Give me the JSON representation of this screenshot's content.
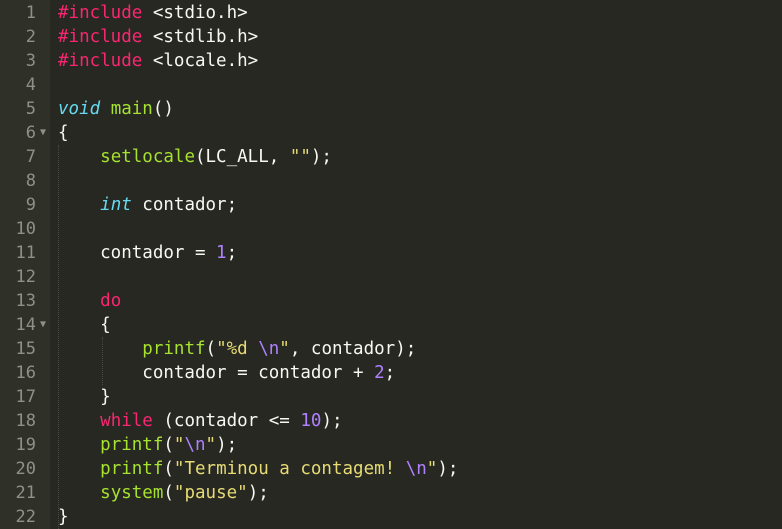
{
  "editor": {
    "lines": [
      {
        "n": "1",
        "fold": false,
        "tokens": [
          {
            "t": "#include",
            "c": "pre"
          },
          {
            "t": " <stdio.h>",
            "c": "inc"
          }
        ]
      },
      {
        "n": "2",
        "fold": false,
        "tokens": [
          {
            "t": "#include",
            "c": "pre"
          },
          {
            "t": " <stdlib.h>",
            "c": "inc"
          }
        ]
      },
      {
        "n": "3",
        "fold": false,
        "tokens": [
          {
            "t": "#include",
            "c": "pre"
          },
          {
            "t": " <locale.h>",
            "c": "inc"
          }
        ]
      },
      {
        "n": "4",
        "fold": false,
        "tokens": []
      },
      {
        "n": "5",
        "fold": false,
        "tokens": [
          {
            "t": "void",
            "c": "type"
          },
          {
            "t": " ",
            "c": "plain"
          },
          {
            "t": "main",
            "c": "fn"
          },
          {
            "t": "()",
            "c": "plain"
          }
        ]
      },
      {
        "n": "6",
        "fold": true,
        "tokens": [
          {
            "t": "{",
            "c": "plain"
          }
        ]
      },
      {
        "n": "7",
        "fold": false,
        "tokens": [
          {
            "t": "    ",
            "c": "plain"
          },
          {
            "t": "setlocale",
            "c": "fn"
          },
          {
            "t": "(LC_ALL, ",
            "c": "plain"
          },
          {
            "t": "\"\"",
            "c": "str"
          },
          {
            "t": ");",
            "c": "plain"
          }
        ]
      },
      {
        "n": "8",
        "fold": false,
        "tokens": []
      },
      {
        "n": "9",
        "fold": false,
        "tokens": [
          {
            "t": "    ",
            "c": "plain"
          },
          {
            "t": "int",
            "c": "type"
          },
          {
            "t": " contador;",
            "c": "plain"
          }
        ]
      },
      {
        "n": "10",
        "fold": false,
        "tokens": []
      },
      {
        "n": "11",
        "fold": false,
        "tokens": [
          {
            "t": "    contador = ",
            "c": "plain"
          },
          {
            "t": "1",
            "c": "num"
          },
          {
            "t": ";",
            "c": "plain"
          }
        ]
      },
      {
        "n": "12",
        "fold": false,
        "tokens": []
      },
      {
        "n": "13",
        "fold": false,
        "tokens": [
          {
            "t": "    ",
            "c": "plain"
          },
          {
            "t": "do",
            "c": "kw"
          }
        ]
      },
      {
        "n": "14",
        "fold": true,
        "tokens": [
          {
            "t": "    {",
            "c": "plain"
          }
        ]
      },
      {
        "n": "15",
        "fold": false,
        "tokens": [
          {
            "t": "        ",
            "c": "plain"
          },
          {
            "t": "printf",
            "c": "fn"
          },
          {
            "t": "(",
            "c": "plain"
          },
          {
            "t": "\"%d ",
            "c": "str"
          },
          {
            "t": "\\n",
            "c": "esc"
          },
          {
            "t": "\"",
            "c": "str"
          },
          {
            "t": ", contador);",
            "c": "plain"
          }
        ]
      },
      {
        "n": "16",
        "fold": false,
        "tokens": [
          {
            "t": "        contador = contador + ",
            "c": "plain"
          },
          {
            "t": "2",
            "c": "num"
          },
          {
            "t": ";",
            "c": "plain"
          }
        ]
      },
      {
        "n": "17",
        "fold": false,
        "tokens": [
          {
            "t": "    }",
            "c": "plain"
          }
        ]
      },
      {
        "n": "18",
        "fold": false,
        "tokens": [
          {
            "t": "    ",
            "c": "plain"
          },
          {
            "t": "while",
            "c": "kw"
          },
          {
            "t": " (contador <= ",
            "c": "plain"
          },
          {
            "t": "10",
            "c": "num"
          },
          {
            "t": ");",
            "c": "plain"
          }
        ]
      },
      {
        "n": "19",
        "fold": false,
        "tokens": [
          {
            "t": "    ",
            "c": "plain"
          },
          {
            "t": "printf",
            "c": "fn"
          },
          {
            "t": "(",
            "c": "plain"
          },
          {
            "t": "\"",
            "c": "str"
          },
          {
            "t": "\\n",
            "c": "esc"
          },
          {
            "t": "\"",
            "c": "str"
          },
          {
            "t": ");",
            "c": "plain"
          }
        ]
      },
      {
        "n": "20",
        "fold": false,
        "tokens": [
          {
            "t": "    ",
            "c": "plain"
          },
          {
            "t": "printf",
            "c": "fn"
          },
          {
            "t": "(",
            "c": "plain"
          },
          {
            "t": "\"Terminou a contagem! ",
            "c": "str"
          },
          {
            "t": "\\n",
            "c": "esc"
          },
          {
            "t": "\"",
            "c": "str"
          },
          {
            "t": ");",
            "c": "plain"
          }
        ]
      },
      {
        "n": "21",
        "fold": false,
        "tokens": [
          {
            "t": "    ",
            "c": "plain"
          },
          {
            "t": "system",
            "c": "fn"
          },
          {
            "t": "(",
            "c": "plain"
          },
          {
            "t": "\"pause\"",
            "c": "str"
          },
          {
            "t": ");",
            "c": "plain"
          }
        ]
      },
      {
        "n": "22",
        "fold": false,
        "tokens": [
          {
            "t": "}",
            "c": "plain"
          }
        ]
      }
    ],
    "fold_icon": "fold-arrow-icon",
    "colors": {
      "background": "#272822",
      "gutter": "#2f3129",
      "line_number": "#8f908a",
      "preprocessor": "#f92672",
      "keyword": "#f92672",
      "type": "#66d9ef",
      "function": "#a6e22e",
      "number": "#ae81ff",
      "string": "#e6db74",
      "escape": "#ae81ff",
      "text": "#f8f8f2"
    }
  }
}
